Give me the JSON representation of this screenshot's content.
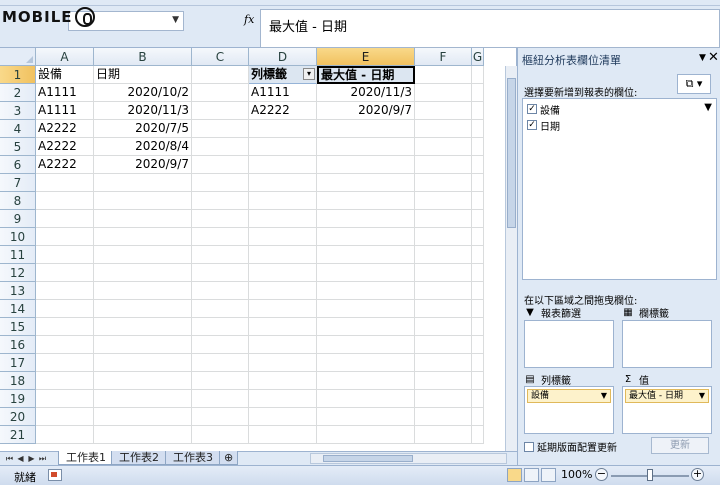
{
  "logo": {
    "text": "MOBILE"
  },
  "formula_bar": {
    "name_box": "",
    "fx": "fx",
    "value": "最大值 - 日期"
  },
  "columns": [
    "A",
    "B",
    "C",
    "D",
    "E",
    "F",
    "G"
  ],
  "rows": [
    "1",
    "2",
    "3",
    "4",
    "5",
    "6",
    "7",
    "8",
    "9",
    "10",
    "11",
    "12",
    "13",
    "14",
    "15",
    "16",
    "17",
    "18",
    "19",
    "20",
    "21"
  ],
  "source_table": {
    "headers": [
      "設備",
      "日期"
    ],
    "rows": [
      [
        "A1111",
        "2020/10/2"
      ],
      [
        "A1111",
        "2020/11/3"
      ],
      [
        "A2222",
        "2020/7/5"
      ],
      [
        "A2222",
        "2020/8/4"
      ],
      [
        "A2222",
        "2020/9/7"
      ]
    ]
  },
  "pivot_table": {
    "row_label_header": "列標籤",
    "value_header": "最大值 - 日期",
    "rows": [
      [
        "A1111",
        "2020/11/3"
      ],
      [
        "A2222",
        "2020/9/7"
      ]
    ]
  },
  "sheet_tabs": [
    "工作表1",
    "工作表2",
    "工作表3"
  ],
  "pane": {
    "title": "樞紐分析表欄位清單",
    "choose_label": "選擇要新增到報表的欄位:",
    "fields": [
      {
        "label": "設備",
        "checked": true
      },
      {
        "label": "日期",
        "checked": true
      }
    ],
    "drag_label": "在以下區域之間拖曳欄位:",
    "areas": {
      "report_filter": "報表篩選",
      "column_labels": "欄標籤",
      "row_labels": "列標籤",
      "values": "值"
    },
    "row_chip": "設備",
    "values_chip": "最大值 - 日期",
    "defer_label": "延期版面配置更新",
    "update_label": "更新"
  },
  "status": {
    "text": "就緒",
    "zoom": "100%"
  },
  "colors": {
    "accent_header": "#f1c15f",
    "pivot_header": "#dce6f1",
    "chip": "#fdf2cb",
    "chrome": "#dfe9f5"
  }
}
